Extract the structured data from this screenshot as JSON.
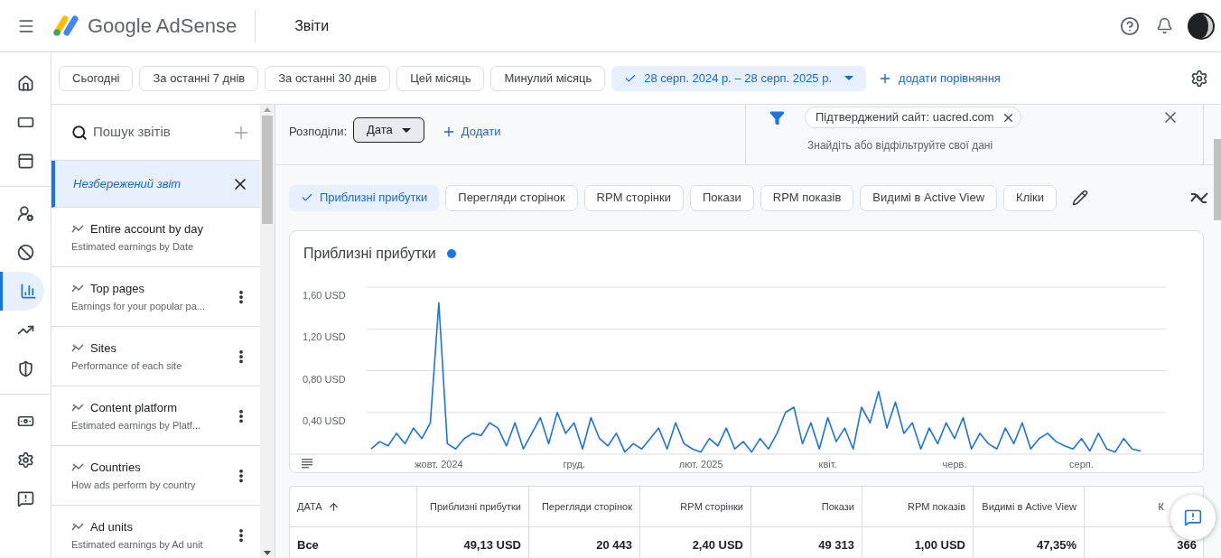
{
  "header": {
    "brand": "Google AdSense",
    "page": "Звіти"
  },
  "nav_groups": [
    {
      "items": [
        {
          "kind": "home",
          "selected": false
        },
        {
          "kind": "ads",
          "selected": false
        },
        {
          "kind": "layout",
          "selected": false
        }
      ]
    },
    {
      "items": [
        {
          "kind": "privacy",
          "selected": false
        },
        {
          "kind": "block",
          "selected": false
        },
        {
          "kind": "reports",
          "selected": true
        },
        {
          "kind": "trend",
          "selected": false
        },
        {
          "kind": "policy",
          "selected": false
        }
      ]
    },
    {
      "items": [
        {
          "kind": "payments",
          "selected": false
        },
        {
          "kind": "settings",
          "selected": false
        },
        {
          "kind": "feedback",
          "selected": false
        }
      ]
    }
  ],
  "date_ranges": [
    {
      "label": "Сьогодні",
      "selected": false
    },
    {
      "label": "За останні 7 днів",
      "selected": false
    },
    {
      "label": "За останні 30 днів",
      "selected": false
    },
    {
      "label": "Цей місяць",
      "selected": false
    },
    {
      "label": "Минулий місяць",
      "selected": false
    },
    {
      "label": "28 серп. 2024 р. – 28 серп. 2025 р.",
      "selected": true
    }
  ],
  "add_comparison": "додати порівняння",
  "report_search": {
    "placeholder": "Пошук звітів"
  },
  "reports": [
    {
      "kind": "unsaved",
      "title": "Незбережений звіт",
      "selected": true
    },
    {
      "kind": "saved",
      "title": "Entire account by day",
      "subtitle": "Estimated earnings by Date",
      "menu_button": false,
      "selected": false
    },
    {
      "kind": "saved",
      "title": "Top pages",
      "subtitle": "Earnings for your popular pa...",
      "menu_button": true,
      "selected": false
    },
    {
      "kind": "saved",
      "title": "Sites",
      "subtitle": "Performance of each site",
      "menu_button": true,
      "selected": false
    },
    {
      "kind": "saved",
      "title": "Content platform",
      "subtitle": "Estimated earnings by Platf...",
      "menu_button": true,
      "selected": false
    },
    {
      "kind": "saved",
      "title": "Countries",
      "subtitle": "How ads perform by country",
      "menu_button": true,
      "selected": false
    },
    {
      "kind": "saved",
      "title": "Ad units",
      "subtitle": "Estimated earnings by Ad unit",
      "menu_button": true,
      "selected": false
    }
  ],
  "breakdown": {
    "label": "Розподіли:",
    "value": "Дата",
    "add": "Додати"
  },
  "filter": {
    "chip": "Підтверджений сайт: uacred.com",
    "placeholder": "Знайдіть або відфільтруйте свої дані"
  },
  "metrics": [
    {
      "label": "Приблизні прибутки",
      "selected": true
    },
    {
      "label": "Перегляди сторінок",
      "selected": false
    },
    {
      "label": "RPM сторінки",
      "selected": false
    },
    {
      "label": "Покази",
      "selected": false
    },
    {
      "label": "RPM показів",
      "selected": false
    },
    {
      "label": "Видимі в Active View",
      "selected": false
    },
    {
      "label": "Кліки",
      "selected": false
    }
  ],
  "chart": {
    "title": "Приблизні прибутки",
    "chart_data": {
      "type": "line",
      "categories": [
        null,
        null,
        null,
        null,
        null,
        null,
        null,
        null,
        "жовт. 2024",
        null,
        null,
        null,
        null,
        null,
        null,
        null,
        null,
        null,
        null,
        null,
        null,
        null,
        null,
        null,
        "груд.",
        null,
        null,
        null,
        null,
        null,
        null,
        null,
        null,
        null,
        null,
        null,
        null,
        null,
        null,
        "лют. 2025",
        null,
        null,
        null,
        null,
        null,
        null,
        null,
        null,
        null,
        null,
        null,
        null,
        null,
        null,
        "квіт.",
        null,
        null,
        null,
        null,
        null,
        null,
        null,
        null,
        null,
        null,
        null,
        null,
        null,
        null,
        "черв.",
        null,
        null,
        null,
        null,
        null,
        null,
        null,
        null,
        null,
        null,
        null,
        null,
        null,
        null,
        "серп.",
        null,
        null,
        null,
        null,
        null,
        null,
        null
      ],
      "series": [
        {
          "color": "#1a73e8",
          "values": [
            0.05,
            0.12,
            0.08,
            0.2,
            0.1,
            0.25,
            0.15,
            0.3,
            1.45,
            0.1,
            0.05,
            0.15,
            0.2,
            0.18,
            0.3,
            0.25,
            0.08,
            0.3,
            0.05,
            0.2,
            0.35,
            0.1,
            0.4,
            0.2,
            0.3,
            0.05,
            0.35,
            0.15,
            0.08,
            0.2,
            0.02,
            0.1,
            0.05,
            0.15,
            0.25,
            0.05,
            0.3,
            0.1,
            0.05,
            0.02,
            0.15,
            0.08,
            0.25,
            0.05,
            0.12,
            0.02,
            0.15,
            0.05,
            0.2,
            0.4,
            0.45,
            0.1,
            0.3,
            0.05,
            0.35,
            0.12,
            0.25,
            0.05,
            0.45,
            0.3,
            0.6,
            0.25,
            0.5,
            0.2,
            0.3,
            0.05,
            0.25,
            0.1,
            0.3,
            0.15,
            0.35,
            0.05,
            0.2,
            0.1,
            0.05,
            0.25,
            0.1,
            0.3,
            0.05,
            0.15,
            0.2,
            0.12,
            0.08,
            0.05,
            0.15,
            0.03,
            0.2,
            0.05,
            0.02,
            0.15,
            0.05,
            0.03
          ]
        }
      ],
      "ylim": [
        0,
        1.6
      ],
      "grid": true,
      "yticks": [
        {
          "value": 0.4,
          "label": "0,40 USD"
        },
        {
          "value": 0.8,
          "label": "0,80 USD"
        },
        {
          "value": 1.2,
          "label": "1,20 USD"
        },
        {
          "value": 1.6,
          "label": "1,60 USD"
        }
      ]
    }
  },
  "table": {
    "columns": [
      {
        "label": "ДАТА",
        "sorted": true
      },
      {
        "label": "Приблизні прибутки",
        "sorted": false
      },
      {
        "label": "Перегляди сторінок",
        "sorted": false
      },
      {
        "label": "RPM сторінки",
        "sorted": false
      },
      {
        "label": "Покази",
        "sorted": false
      },
      {
        "label": "RPM показів",
        "sorted": false
      },
      {
        "label": "Видимі в Active View",
        "sorted": false
      },
      {
        "label": "К",
        "sorted": false
      }
    ],
    "rows": [
      {
        "cells": [
          "Все",
          "49,13 USD",
          "20 443",
          "2,40 USD",
          "49 313",
          "1,00 USD",
          "47,35%",
          "366"
        ]
      }
    ]
  }
}
